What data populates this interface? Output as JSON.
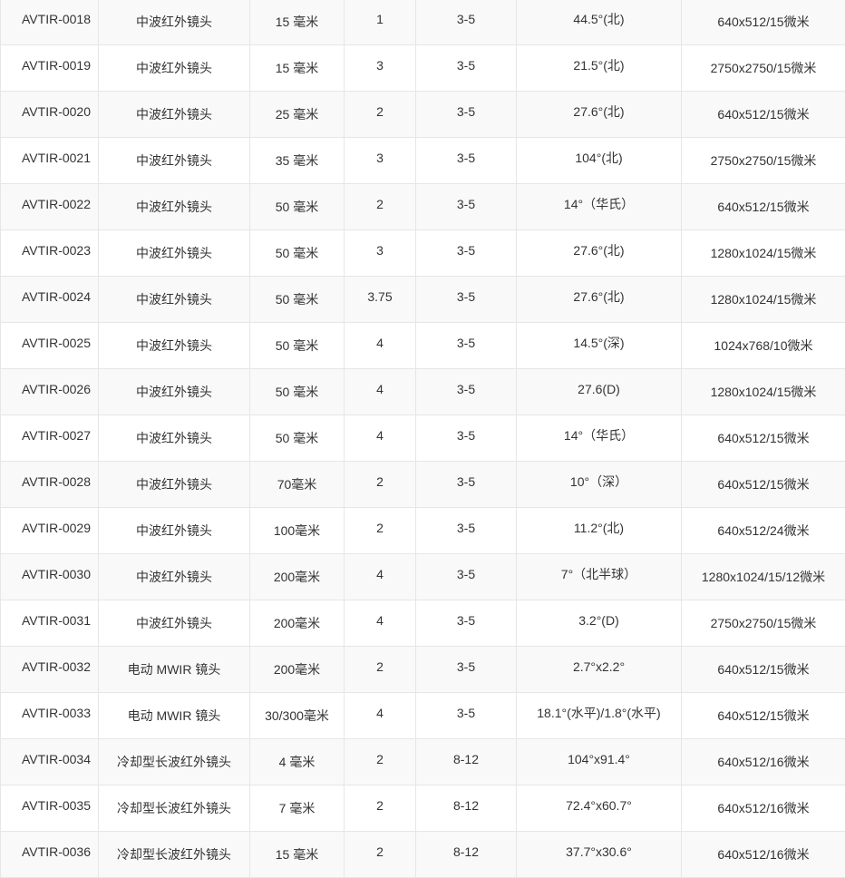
{
  "rows": [
    {
      "model": "AVTIR-0018",
      "type": "中波红外镜头",
      "focal": "15 毫米",
      "fnum": "1",
      "band": "3-5",
      "fov": "44.5°(北)",
      "detector": "640x512/15微米"
    },
    {
      "model": "AVTIR-0019",
      "type": "中波红外镜头",
      "focal": "15 毫米",
      "fnum": "3",
      "band": "3-5",
      "fov": "21.5°(北)",
      "detector": "2750x2750/15微米"
    },
    {
      "model": "AVTIR-0020",
      "type": "中波红外镜头",
      "focal": "25 毫米",
      "fnum": "2",
      "band": "3-5",
      "fov": "27.6°(北)",
      "detector": "640x512/15微米"
    },
    {
      "model": "AVTIR-0021",
      "type": "中波红外镜头",
      "focal": "35 毫米",
      "fnum": "3",
      "band": "3-5",
      "fov": "104°(北)",
      "detector": "2750x2750/15微米"
    },
    {
      "model": "AVTIR-0022",
      "type": "中波红外镜头",
      "focal": "50 毫米",
      "fnum": "2",
      "band": "3-5",
      "fov": "14°（华氏）",
      "detector": "640x512/15微米"
    },
    {
      "model": "AVTIR-0023",
      "type": "中波红外镜头",
      "focal": "50 毫米",
      "fnum": "3",
      "band": "3-5",
      "fov": "27.6°(北)",
      "detector": "1280x1024/15微米"
    },
    {
      "model": "AVTIR-0024",
      "type": "中波红外镜头",
      "focal": "50 毫米",
      "fnum": "3.75",
      "band": "3-5",
      "fov": "27.6°(北)",
      "detector": "1280x1024/15微米"
    },
    {
      "model": "AVTIR-0025",
      "type": "中波红外镜头",
      "focal": "50 毫米",
      "fnum": "4",
      "band": "3-5",
      "fov": "14.5°(深)",
      "detector": "1024x768/10微米"
    },
    {
      "model": "AVTIR-0026",
      "type": "中波红外镜头",
      "focal": "50 毫米",
      "fnum": "4",
      "band": "3-5",
      "fov": "27.6(D)",
      "detector": "1280x1024/15微米"
    },
    {
      "model": "AVTIR-0027",
      "type": "中波红外镜头",
      "focal": "50 毫米",
      "fnum": "4",
      "band": "3-5",
      "fov": "14°（华氏）",
      "detector": "640x512/15微米"
    },
    {
      "model": "AVTIR-0028",
      "type": "中波红外镜头",
      "focal": "70毫米",
      "fnum": "2",
      "band": "3-5",
      "fov": "10°（深）",
      "detector": "640x512/15微米"
    },
    {
      "model": "AVTIR-0029",
      "type": "中波红外镜头",
      "focal": "100毫米",
      "fnum": "2",
      "band": "3-5",
      "fov": "11.2°(北)",
      "detector": "640x512/24微米"
    },
    {
      "model": "AVTIR-0030",
      "type": "中波红外镜头",
      "focal": "200毫米",
      "fnum": "4",
      "band": "3-5",
      "fov": "7°（北半球）",
      "detector": "1280x1024/15/12微米"
    },
    {
      "model": "AVTIR-0031",
      "type": "中波红外镜头",
      "focal": "200毫米",
      "fnum": "4",
      "band": "3-5",
      "fov": "3.2°(D)",
      "detector": "2750x2750/15微米"
    },
    {
      "model": "AVTIR-0032",
      "type": "电动 MWIR 镜头",
      "focal": "200毫米",
      "fnum": "2",
      "band": "3-5",
      "fov": "2.7°x2.2°",
      "detector": "640x512/15微米"
    },
    {
      "model": "AVTIR-0033",
      "type": "电动 MWIR 镜头",
      "focal": "30/300毫米",
      "fnum": "4",
      "band": "3-5",
      "fov": "18.1°(水平)/1.8°(水平)",
      "detector": "640x512/15微米"
    },
    {
      "model": "AVTIR-0034",
      "type": "冷却型长波红外镜头",
      "focal": "4 毫米",
      "fnum": "2",
      "band": "8-12",
      "fov": "104°x91.4°",
      "detector": "640x512/16微米"
    },
    {
      "model": "AVTIR-0035",
      "type": "冷却型长波红外镜头",
      "focal": "7 毫米",
      "fnum": "2",
      "band": "8-12",
      "fov": "72.4°x60.7°",
      "detector": "640x512/16微米"
    },
    {
      "model": "AVTIR-0036",
      "type": "冷却型长波红外镜头",
      "focal": "15 毫米",
      "fnum": "2",
      "band": "8-12",
      "fov": "37.7°x30.6°",
      "detector": "640x512/16微米"
    }
  ]
}
